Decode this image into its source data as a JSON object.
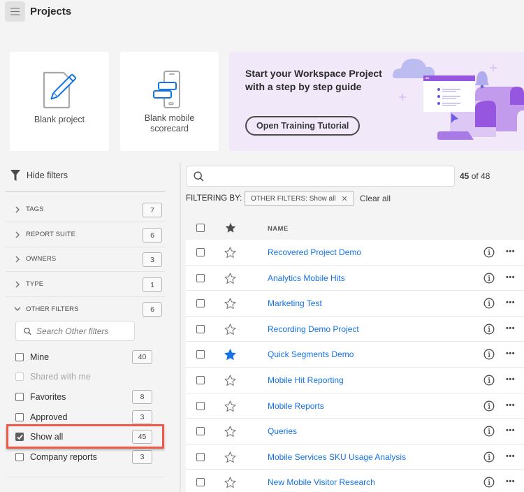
{
  "header": {
    "title": "Projects",
    "menu_icon": "hamburger-menu-icon"
  },
  "cards": [
    {
      "label": "Blank project",
      "icon": "pencil-document-icon"
    },
    {
      "label_line1": "Blank mobile",
      "label_line2": "scorecard",
      "icon": "mobile-scorecard-icon"
    }
  ],
  "banner": {
    "title_line1": "Start your Workspace Project",
    "title_line2": "with a step by step guide",
    "button_label": "Open Training Tutorial",
    "illustration": "workspace-tutorial-illustration",
    "colors": {
      "background": "#f1e8f9",
      "purple": "#9756e0",
      "lavender": "#b6b3ef"
    }
  },
  "sidebar": {
    "hide_filters_label": "Hide filters",
    "facets": [
      {
        "name": "TAGS",
        "count": "7",
        "expanded": false
      },
      {
        "name": "REPORT SUITE",
        "count": "6",
        "expanded": false
      },
      {
        "name": "OWNERS",
        "count": "3",
        "expanded": false
      },
      {
        "name": "TYPE",
        "count": "1",
        "expanded": false
      },
      {
        "name": "OTHER FILTERS",
        "count": "6",
        "expanded": true
      }
    ],
    "other_filters_search_placeholder": "Search Other filters",
    "other_filters": [
      {
        "label": "Mine",
        "count": "40",
        "checked": false,
        "disabled": false
      },
      {
        "label": "Shared with me",
        "count": "",
        "checked": false,
        "disabled": true
      },
      {
        "label": "Favorites",
        "count": "8",
        "checked": false,
        "disabled": false
      },
      {
        "label": "Approved",
        "count": "3",
        "checked": false,
        "disabled": false
      },
      {
        "label": "Show all",
        "count": "45",
        "checked": true,
        "disabled": false,
        "highlighted": true
      },
      {
        "label": "Company reports",
        "count": "3",
        "checked": false,
        "disabled": false
      }
    ],
    "highlight_color": "#f0584a"
  },
  "main": {
    "search_placeholder": "",
    "result_count_shown": "45",
    "result_count_total": " of 48",
    "filtering_by_label": "FILTERING BY:",
    "active_filter_tag": "OTHER FILTERS: Show all",
    "clear_all_label": "Clear all",
    "table": {
      "name_header": "NAME",
      "link_color": "#1473e6",
      "rows": [
        {
          "name": "Recovered Project Demo",
          "favorite": false
        },
        {
          "name": "Analytics Mobile Hits",
          "favorite": false
        },
        {
          "name": "Marketing Test",
          "favorite": false
        },
        {
          "name": "Recording Demo Project",
          "favorite": false
        },
        {
          "name": "Quick Segments Demo",
          "favorite": true
        },
        {
          "name": "Mobile Hit Reporting",
          "favorite": false
        },
        {
          "name": "Mobile Reports",
          "favorite": false
        },
        {
          "name": "Queries",
          "favorite": false
        },
        {
          "name": "Mobile Services SKU Usage Analysis",
          "favorite": false
        },
        {
          "name": "New Mobile Visitor Research",
          "favorite": false
        }
      ],
      "more_label": "•••"
    }
  }
}
